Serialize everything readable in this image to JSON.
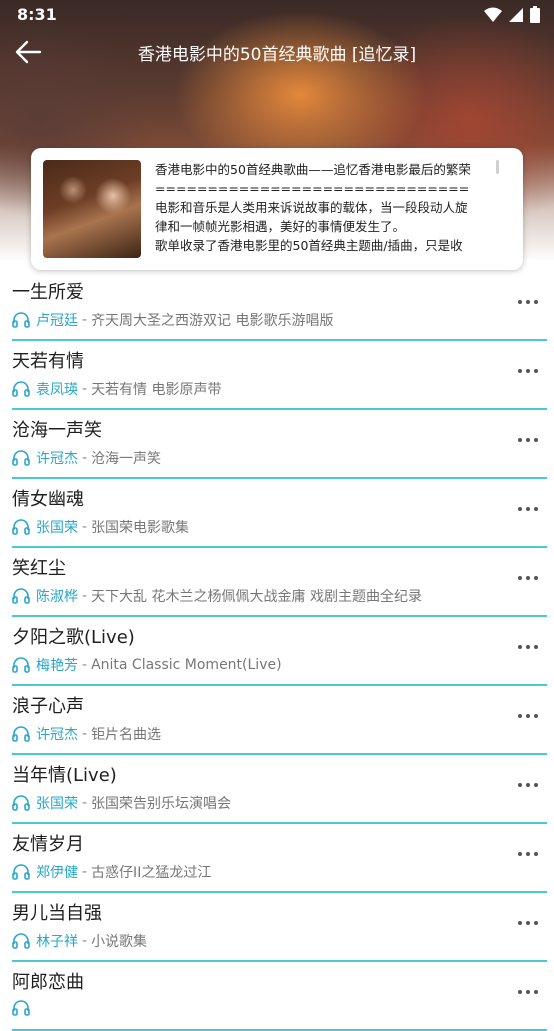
{
  "status_bar": {
    "time": "8:31"
  },
  "header": {
    "title": "香港电影中的50首经典歌曲 [追忆录]"
  },
  "playlist": {
    "description_lines": [
      "香港电影中的50首经典歌曲——追忆香港电影最后的繁荣",
      "==============================",
      "电影和音乐是人类用来诉说故事的载体，当一段段动人旋",
      "律和一帧帧光影相遇，美好的事情便发生了。",
      "歌单收录了香港电影里的50首经典主题曲/插曲，只是收"
    ]
  },
  "songs": [
    {
      "title": "一生所爱",
      "artist": "卢冠廷",
      "album": "齐天周大圣之西游双记 电影歌乐游唱版"
    },
    {
      "title": "天若有情",
      "artist": "袁凤瑛",
      "album": "天若有情 电影原声带"
    },
    {
      "title": "沧海一声笑",
      "artist": "许冠杰",
      "album": "沧海一声笑"
    },
    {
      "title": "倩女幽魂",
      "artist": "张国荣",
      "album": "张国荣电影歌集"
    },
    {
      "title": "笑红尘",
      "artist": "陈淑桦",
      "album": "天下大乱 花木兰之杨佩佩大战金庸 戏剧主题曲全纪录"
    },
    {
      "title": "夕阳之歌(Live)",
      "artist": "梅艳芳",
      "album": "Anita Classic Moment(Live)"
    },
    {
      "title": "浪子心声",
      "artist": "许冠杰",
      "album": "钜片名曲选"
    },
    {
      "title": "当年情(Live)",
      "artist": "张国荣",
      "album": "张国荣告别乐坛演唱会"
    },
    {
      "title": "友情岁月",
      "artist": "郑伊健",
      "album": "古惑仔II之猛龙过江"
    },
    {
      "title": "男儿当自强",
      "artist": "林子祥",
      "album": "小说歌集"
    },
    {
      "title": "阿郎恋曲",
      "artist": "",
      "album": ""
    }
  ],
  "meta_separator": "-",
  "colors": {
    "accent": "#2aa7c9",
    "divider": "#4ac8d6"
  }
}
